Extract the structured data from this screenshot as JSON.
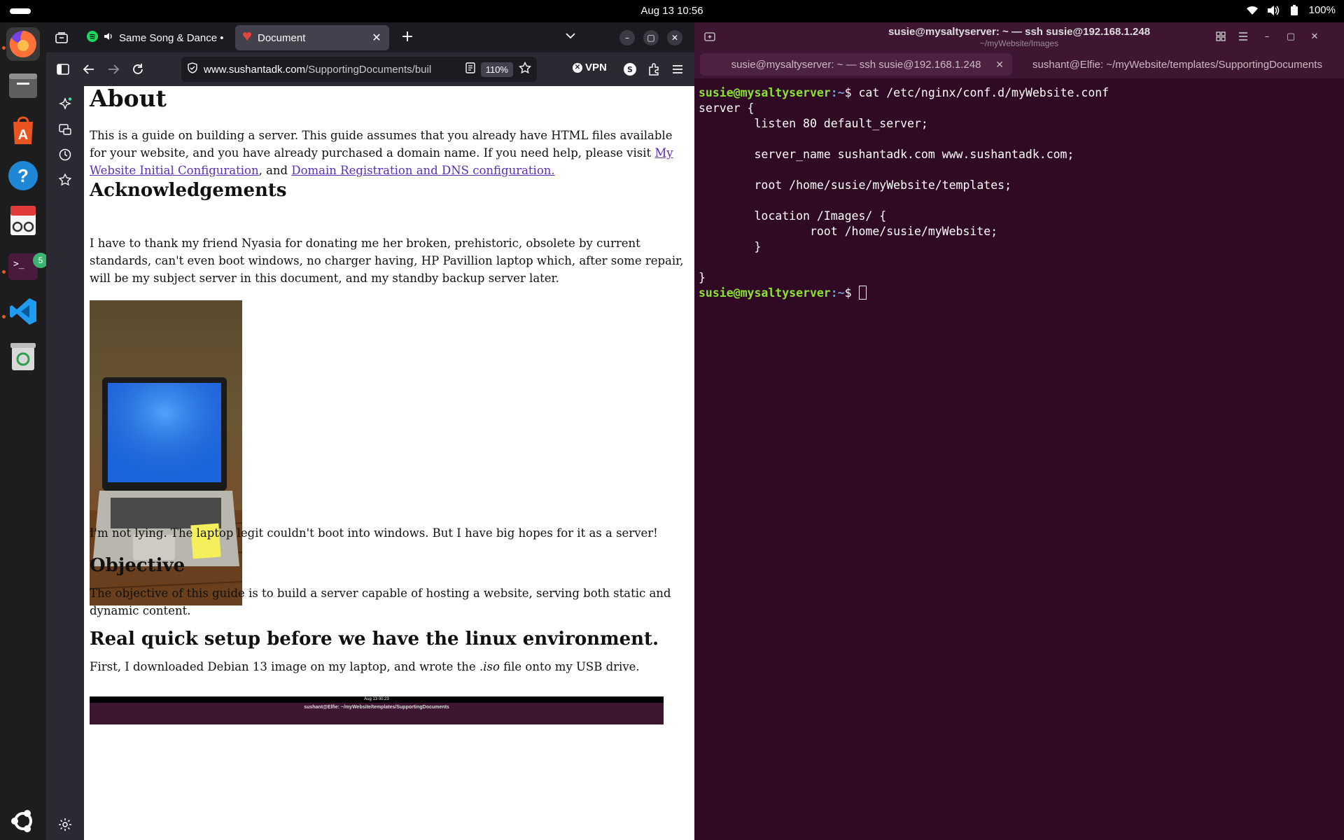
{
  "topbar": {
    "clock": "Aug 13  10:56",
    "battery": "100%"
  },
  "dock": {
    "items": [
      "firefox-icon",
      "files-icon",
      "app-center-icon",
      "help-icon",
      "document-viewer-icon",
      "terminal-icon",
      "vscode-icon",
      "trash-icon",
      "app-grid-icon"
    ],
    "terminal_badge": "5"
  },
  "firefox": {
    "tabs": [
      {
        "label": "Same Song & Dance • I"
      },
      {
        "label": "Document"
      }
    ],
    "url_domain": "www.sushantadk.com",
    "url_path": "/SupportingDocuments/buil",
    "zoom": "110%",
    "vpn_label": "VPN",
    "account_initial": "S"
  },
  "page": {
    "h_about": "About",
    "p_about_1": "This is a guide on building a server. This guide assumes that you already have HTML files available for your website, and you have already purchased a domain name. If you need help, please visit ",
    "link_1": "My Website Initial Configuration",
    "p_about_2": ", and ",
    "link_2": "Domain Registration and DNS configuration.",
    "h_ack": "Acknowledgements",
    "p_ack": "I have to thank my friend Nyasia for donating me her broken, prehistoric, obsolete by current standards, can't even boot windows, no charger having, HP Pavillion laptop which, after some repair, will be my subject server in this document, and my standby backup server later.",
    "p_lying": "I'm not lying. The laptop legit couldn't boot into windows. But I have big hopes for it as a server!",
    "h_obj": "Objective",
    "p_obj": "The objective of this guide is to build a server capable of hosting a website, serving both static and dynamic content.",
    "h_setup": "Real quick setup before we have the linux environment.",
    "p_setup_1": "First, I downloaded Debian 13 image on my laptop, and wrote the ",
    "p_setup_em": ".iso",
    "p_setup_2": " file onto my USB drive.",
    "strip_title": "sushant@Elfie: ~/myWebsite/templates/SupportingDocuments",
    "strip_clock": "Aug 13  00:23"
  },
  "terminal": {
    "title": "susie@mysaltyserver: ~ — ssh susie@192.168.1.248",
    "subtitle": "~/myWebsite/Images",
    "tabs": [
      {
        "label": "susie@mysaltyserver: ~ — ssh susie@192.168.1.248"
      },
      {
        "label": "sushant@Elfie: ~/myWebsite/templates/SupportingDocuments"
      }
    ],
    "prompt_user": "susie@mysaltyserver",
    "prompt_path": ":~",
    "prompt_end": "$ ",
    "command": "cat /etc/nginx/conf.d/myWebsite.conf",
    "output": [
      "server {",
      "        listen 80 default_server;",
      "",
      "        server_name sushantadk.com www.sushantadk.com;",
      "",
      "        root /home/susie/myWebsite/templates;",
      "",
      "        location /Images/ {",
      "                root /home/susie/myWebsite;",
      "        }",
      "",
      "}"
    ]
  }
}
